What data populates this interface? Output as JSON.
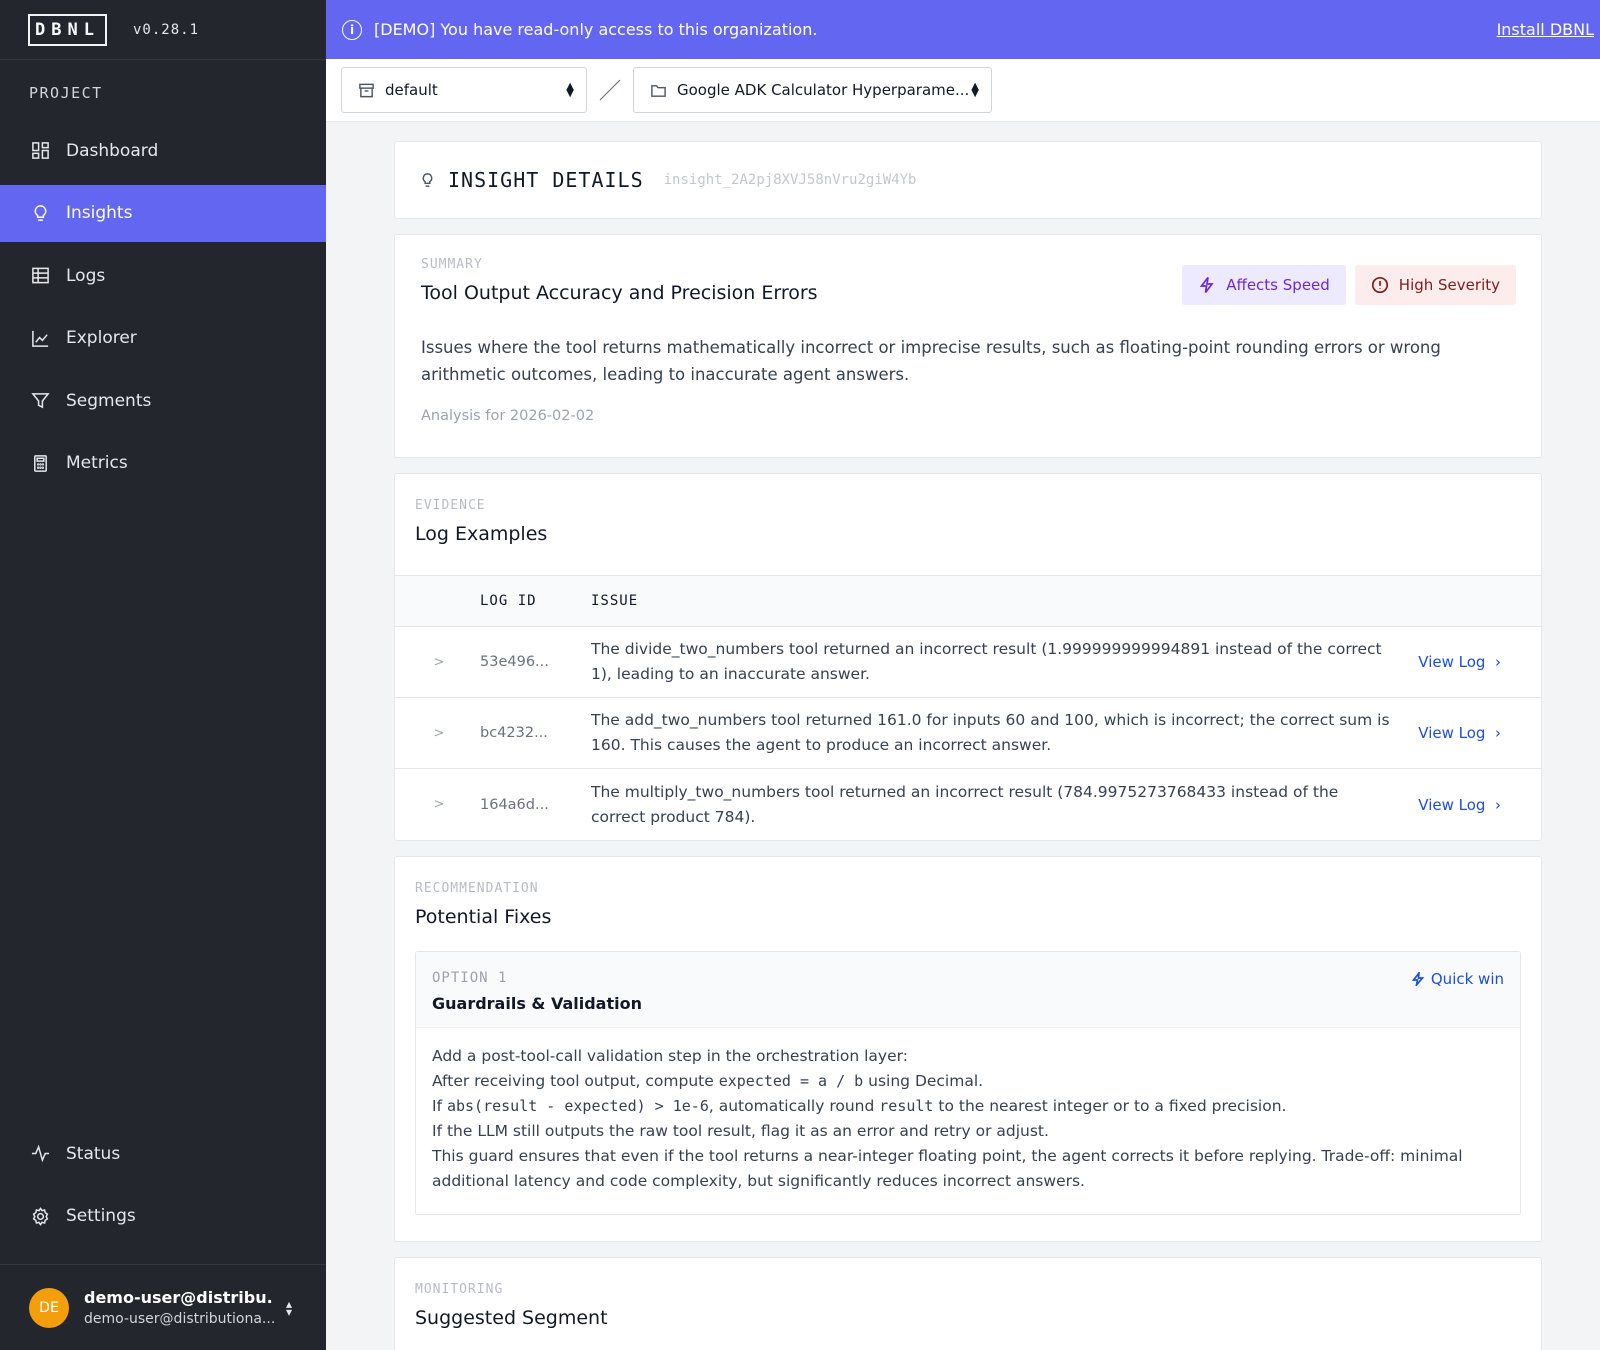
{
  "app": {
    "logo_letters": [
      "D",
      "B",
      "N",
      "L"
    ],
    "version": "v0.28.1"
  },
  "sidebar": {
    "section_label": "PROJECT",
    "items": [
      {
        "label": "Dashboard",
        "icon": "dashboard-icon"
      },
      {
        "label": "Insights",
        "icon": "lightbulb-icon",
        "active": true
      },
      {
        "label": "Logs",
        "icon": "table-icon"
      },
      {
        "label": "Explorer",
        "icon": "line-chart-icon"
      },
      {
        "label": "Segments",
        "icon": "filter-icon"
      },
      {
        "label": "Metrics",
        "icon": "calculator-icon"
      }
    ],
    "bottom_items": [
      {
        "label": "Status",
        "icon": "activity-icon"
      },
      {
        "label": "Settings",
        "icon": "gear-icon"
      }
    ],
    "user": {
      "initials": "DE",
      "name": "demo-user@distribu...",
      "email": "demo-user@distributiona...",
      "avatar_color": "#f59e0b"
    }
  },
  "banner": {
    "message": "[DEMO] You have read-only access to this organization.",
    "link": "Install DBNL",
    "color": "#6366f1"
  },
  "toolbar": {
    "namespace": "default",
    "project": "Google ADK Calculator Hyperparame..."
  },
  "insight": {
    "title": "INSIGHT DETAILS",
    "id": "insight_2A2pj8XVJ58nVru2giW4Yb"
  },
  "summary": {
    "kicker": "SUMMARY",
    "title": "Tool Output Accuracy and Precision Errors",
    "badges": {
      "speed": "Affects Speed",
      "severity": "High Severity"
    },
    "description": "Issues where the tool returns mathematically incorrect or imprecise results, such as floating-point rounding errors or wrong arithmetic outcomes, leading to inaccurate agent answers.",
    "analysis": "Analysis for 2026-02-02"
  },
  "evidence": {
    "kicker": "EVIDENCE",
    "title": "Log Examples",
    "columns": {
      "log_id": "LOG ID",
      "issue": "ISSUE"
    },
    "action_label": "View Log",
    "rows": [
      {
        "id": "53e496...",
        "issue": "The divide_two_numbers tool returned an incorrect result (1.999999999994891 instead of the correct 1), leading to an inaccurate answer."
      },
      {
        "id": "bc4232...",
        "issue": "The add_two_numbers tool returned 161.0 for inputs 60 and 100, which is incorrect; the correct sum is 160. This causes the agent to produce an incorrect answer."
      },
      {
        "id": "164a6d...",
        "issue": "The multiply_two_numbers tool returned an incorrect result (784.9975273768433 instead of the correct product 784)."
      }
    ]
  },
  "recommendation": {
    "kicker": "RECOMMENDATION",
    "title": "Potential Fixes",
    "option": {
      "label": "OPTION 1",
      "title": "Guardrails & Validation",
      "tag": "Quick win",
      "lines": {
        "l1": "Add a post-tool-call validation step in the orchestration layer:",
        "l2_pre": "After receiving tool output, compute ",
        "l2_code": "expected = a / b",
        "l2_post": " using Decimal.",
        "l3_pre": "If ",
        "l3_code": "abs(result - expected) > 1e-6",
        "l3_mid": ", automatically round ",
        "l3_code2": "result",
        "l3_post": " to the nearest integer or to a fixed precision.",
        "l4": "If the LLM still outputs the raw tool result, flag it as an error and retry or adjust.",
        "l5": "This guard ensures that even if the tool returns a near-integer floating point, the agent corrects it before replying. Trade-off: minimal additional latency and code complexity, but significantly reduces incorrect answers."
      }
    }
  },
  "monitoring": {
    "kicker": "MONITORING",
    "title": "Suggested Segment"
  }
}
